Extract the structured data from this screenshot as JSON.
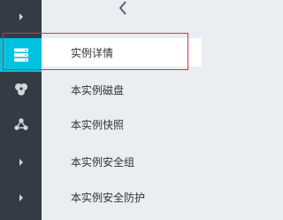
{
  "back": {
    "icon": "chevron-left-icon"
  },
  "rail": {
    "items": [
      {
        "icon": "caret-right-icon"
      },
      {
        "icon": "server-icon",
        "active": true
      },
      {
        "icon": "disk-icon"
      },
      {
        "icon": "network-icon"
      },
      {
        "icon": "caret-right-icon"
      },
      {
        "icon": "caret-right-icon"
      }
    ]
  },
  "nav": {
    "items": [
      {
        "label": "实例详情",
        "selected": true
      },
      {
        "label": "本实例磁盘"
      },
      {
        "label": "本实例快照"
      },
      {
        "label": "本实例安全组"
      },
      {
        "label": "本实例安全防护"
      }
    ]
  },
  "colors": {
    "rail": "#333c45",
    "accent": "#00c1de",
    "highlight": "#d9363e",
    "panel": "#eaedf1"
  }
}
